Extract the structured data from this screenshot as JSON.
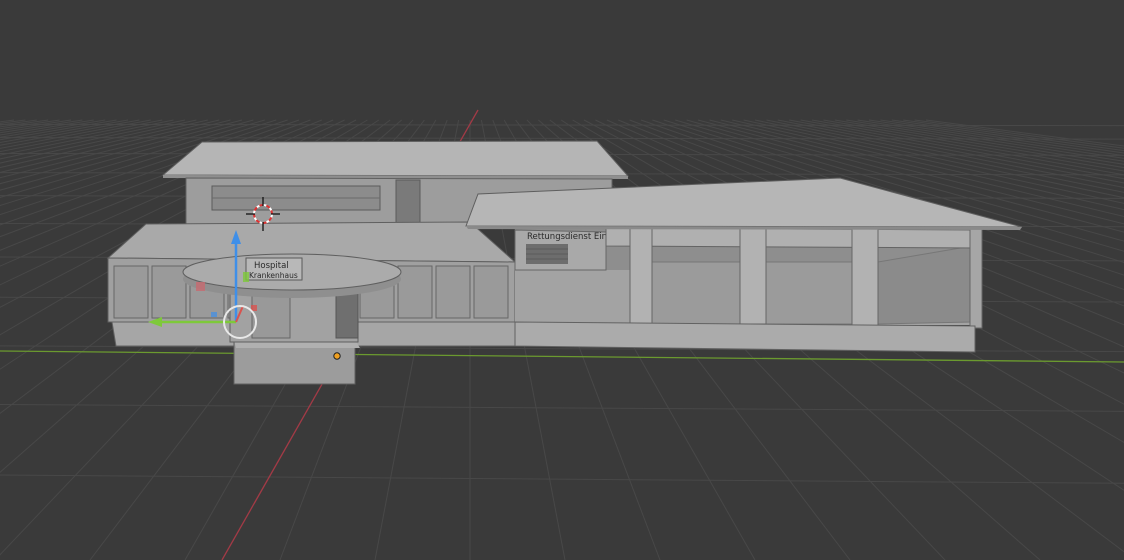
{
  "viewport": {
    "label": "3D Viewport",
    "background": "#3a3a3a",
    "grid_color": "#474747",
    "x_axis_color": "#b3414f",
    "y_axis_color": "#7aa83a"
  },
  "model": {
    "signs": {
      "rescue_entrance": "Rettungsdienst Einfahrt",
      "kiosk_line1": "Hospital",
      "kiosk_line2": "Krankenhaus"
    }
  },
  "gizmo": {
    "x_color": "#7ec93a",
    "z_color": "#3f8fe8",
    "origin_color": "#f0a020"
  }
}
